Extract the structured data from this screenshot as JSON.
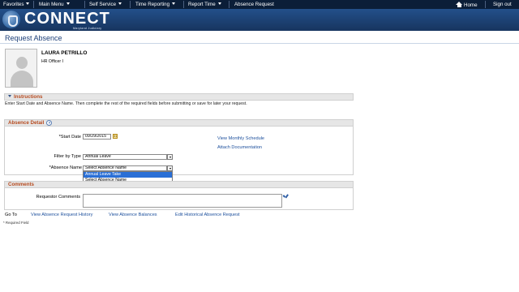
{
  "topnav": {
    "favorites": "Favorites",
    "main_menu": "Main Menu",
    "self_service": "Self Service",
    "time_reporting": "Time Reporting",
    "report_time": "Report Time",
    "absence_request": "Absence Request",
    "home": "Home",
    "sign_out": "Sign out"
  },
  "banner": {
    "logo_text": "CONNECT",
    "logo_sub": "Maryland Judiciary"
  },
  "page": {
    "title": "Request Absence"
  },
  "employee": {
    "name": "LAURA PETRILLO",
    "title": "HR Officer I"
  },
  "instructions": {
    "header": "Instructions",
    "text": "Enter Start Date and Absence Name. Then complete the rest of the required fields before submitting or save for later your request."
  },
  "absence_detail": {
    "header": "Absence Detail",
    "help": "?",
    "start_date_label": "*Start Date",
    "start_date_value": "09/29/2015",
    "calendar_glyph": "31",
    "filter_label": "Filter by Type",
    "filter_value": "Annual Leave",
    "absence_name_label": "*Absence Name",
    "absence_name_value": "Select Absence Name",
    "absence_name_options": [
      "Annual Leave Take",
      "Select Absence Name"
    ],
    "view_schedule": "View Monthly Schedule",
    "attach_doc": "Attach Documentation"
  },
  "comments": {
    "header": "Comments",
    "requestor_label": "Requestor Comments"
  },
  "goto": {
    "label": "Go To",
    "links": [
      "View Absence Request History",
      "View Absence Balances",
      "Edit Historical Absence Request"
    ]
  },
  "footnote": "* Required Field"
}
